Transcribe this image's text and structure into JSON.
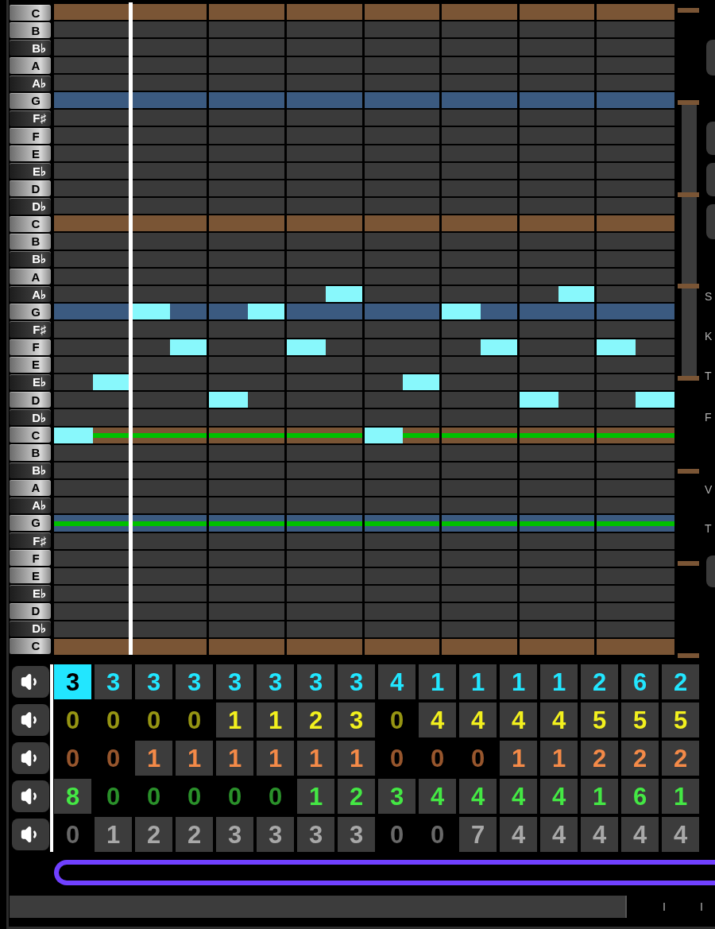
{
  "piano_roll": {
    "keys": [
      {
        "label": "C",
        "kind": "white",
        "color": "#7a5535",
        "guide": false,
        "notes": [
          false,
          false,
          false,
          false,
          false,
          false,
          false,
          false,
          false,
          false,
          false,
          false,
          false,
          false,
          false,
          false
        ]
      },
      {
        "label": "B",
        "kind": "white",
        "guide": false,
        "notes": [
          false,
          false,
          false,
          false,
          false,
          false,
          false,
          false,
          false,
          false,
          false,
          false,
          false,
          false,
          false,
          false
        ]
      },
      {
        "label": "B♭",
        "kind": "black",
        "guide": false,
        "notes": [
          false,
          false,
          false,
          false,
          false,
          false,
          false,
          false,
          false,
          false,
          false,
          false,
          false,
          false,
          false,
          false
        ]
      },
      {
        "label": "A",
        "kind": "white",
        "guide": false,
        "notes": [
          false,
          false,
          false,
          false,
          false,
          false,
          false,
          false,
          false,
          false,
          false,
          false,
          false,
          false,
          false,
          false
        ]
      },
      {
        "label": "A♭",
        "kind": "black",
        "guide": false,
        "notes": [
          false,
          false,
          false,
          false,
          false,
          false,
          false,
          false,
          false,
          false,
          false,
          false,
          false,
          false,
          false,
          false
        ]
      },
      {
        "label": "G",
        "kind": "white",
        "color": "#3b5a80",
        "guide": false,
        "notes": [
          false,
          false,
          false,
          false,
          false,
          false,
          false,
          false,
          false,
          false,
          false,
          false,
          false,
          false,
          false,
          false
        ]
      },
      {
        "label": "F♯",
        "kind": "black",
        "guide": false,
        "notes": [
          false,
          false,
          false,
          false,
          false,
          false,
          false,
          false,
          false,
          false,
          false,
          false,
          false,
          false,
          false,
          false
        ]
      },
      {
        "label": "F",
        "kind": "white",
        "guide": false,
        "notes": [
          false,
          false,
          false,
          false,
          false,
          false,
          false,
          false,
          false,
          false,
          false,
          false,
          false,
          false,
          false,
          false
        ]
      },
      {
        "label": "E",
        "kind": "white",
        "guide": false,
        "notes": [
          false,
          false,
          false,
          false,
          false,
          false,
          false,
          false,
          false,
          false,
          false,
          false,
          false,
          false,
          false,
          false
        ]
      },
      {
        "label": "E♭",
        "kind": "black",
        "guide": false,
        "notes": [
          false,
          false,
          false,
          false,
          false,
          false,
          false,
          false,
          false,
          false,
          false,
          false,
          false,
          false,
          false,
          false
        ]
      },
      {
        "label": "D",
        "kind": "white",
        "guide": false,
        "notes": [
          false,
          false,
          false,
          false,
          false,
          false,
          false,
          false,
          false,
          false,
          false,
          false,
          false,
          false,
          false,
          false
        ]
      },
      {
        "label": "D♭",
        "kind": "black",
        "guide": false,
        "notes": [
          false,
          false,
          false,
          false,
          false,
          false,
          false,
          false,
          false,
          false,
          false,
          false,
          false,
          false,
          false,
          false
        ]
      },
      {
        "label": "C",
        "kind": "white",
        "color": "#7a5535",
        "guide": false,
        "notes": [
          false,
          false,
          false,
          false,
          false,
          false,
          false,
          false,
          false,
          false,
          false,
          false,
          false,
          false,
          false,
          false
        ]
      },
      {
        "label": "B",
        "kind": "white",
        "guide": false,
        "notes": [
          false,
          false,
          false,
          false,
          false,
          false,
          false,
          false,
          false,
          false,
          false,
          false,
          false,
          false,
          false,
          false
        ]
      },
      {
        "label": "B♭",
        "kind": "black",
        "guide": false,
        "notes": [
          false,
          false,
          false,
          false,
          false,
          false,
          false,
          false,
          false,
          false,
          false,
          false,
          false,
          false,
          false,
          false
        ]
      },
      {
        "label": "A",
        "kind": "white",
        "guide": false,
        "notes": [
          false,
          false,
          false,
          false,
          false,
          false,
          false,
          false,
          false,
          false,
          false,
          false,
          false,
          false,
          false,
          false
        ]
      },
      {
        "label": "A♭",
        "kind": "black",
        "guide": false,
        "notes": [
          false,
          false,
          false,
          false,
          false,
          false,
          false,
          true,
          false,
          false,
          false,
          false,
          false,
          true,
          false,
          false
        ]
      },
      {
        "label": "G",
        "kind": "white",
        "color": "#3b5a80",
        "guide": false,
        "notes": [
          false,
          false,
          true,
          false,
          false,
          true,
          false,
          false,
          false,
          false,
          true,
          false,
          false,
          false,
          false,
          false
        ]
      },
      {
        "label": "F♯",
        "kind": "black",
        "guide": false,
        "notes": [
          false,
          false,
          false,
          false,
          false,
          false,
          false,
          false,
          false,
          false,
          false,
          false,
          false,
          false,
          false,
          false
        ]
      },
      {
        "label": "F",
        "kind": "white",
        "guide": false,
        "notes": [
          false,
          false,
          false,
          true,
          false,
          false,
          true,
          false,
          false,
          false,
          false,
          true,
          false,
          false,
          true,
          false
        ]
      },
      {
        "label": "E",
        "kind": "white",
        "guide": false,
        "notes": [
          false,
          false,
          false,
          false,
          false,
          false,
          false,
          false,
          false,
          false,
          false,
          false,
          false,
          false,
          false,
          false
        ]
      },
      {
        "label": "E♭",
        "kind": "black",
        "guide": false,
        "notes": [
          false,
          true,
          false,
          false,
          false,
          false,
          false,
          false,
          false,
          true,
          false,
          false,
          false,
          false,
          false,
          false
        ]
      },
      {
        "label": "D",
        "kind": "white",
        "guide": false,
        "notes": [
          false,
          false,
          false,
          false,
          true,
          false,
          false,
          false,
          false,
          false,
          false,
          false,
          true,
          false,
          false,
          true
        ]
      },
      {
        "label": "D♭",
        "kind": "black",
        "guide": false,
        "notes": [
          false,
          false,
          false,
          false,
          false,
          false,
          false,
          false,
          false,
          false,
          false,
          false,
          false,
          false,
          false,
          false
        ]
      },
      {
        "label": "C",
        "kind": "white",
        "color": "#7a5535",
        "guide": true,
        "notes": [
          true,
          false,
          false,
          false,
          false,
          false,
          false,
          false,
          true,
          false,
          false,
          false,
          false,
          false,
          false,
          false
        ]
      },
      {
        "label": "B",
        "kind": "white",
        "guide": false,
        "notes": [
          false,
          false,
          false,
          false,
          false,
          false,
          false,
          false,
          false,
          false,
          false,
          false,
          false,
          false,
          false,
          false
        ]
      },
      {
        "label": "B♭",
        "kind": "black",
        "guide": false,
        "notes": [
          false,
          false,
          false,
          false,
          false,
          false,
          false,
          false,
          false,
          false,
          false,
          false,
          false,
          false,
          false,
          false
        ]
      },
      {
        "label": "A",
        "kind": "white",
        "guide": false,
        "notes": [
          false,
          false,
          false,
          false,
          false,
          false,
          false,
          false,
          false,
          false,
          false,
          false,
          false,
          false,
          false,
          false
        ]
      },
      {
        "label": "A♭",
        "kind": "black",
        "guide": false,
        "notes": [
          false,
          false,
          false,
          false,
          false,
          false,
          false,
          false,
          false,
          false,
          false,
          false,
          false,
          false,
          false,
          false
        ]
      },
      {
        "label": "G",
        "kind": "white",
        "color": "#3b5a80",
        "guide": true,
        "notes": [
          false,
          false,
          false,
          false,
          false,
          false,
          false,
          false,
          false,
          false,
          false,
          false,
          false,
          false,
          false,
          false
        ]
      },
      {
        "label": "F♯",
        "kind": "black",
        "guide": false,
        "notes": [
          false,
          false,
          false,
          false,
          false,
          false,
          false,
          false,
          false,
          false,
          false,
          false,
          false,
          false,
          false,
          false
        ]
      },
      {
        "label": "F",
        "kind": "white",
        "guide": false,
        "notes": [
          false,
          false,
          false,
          false,
          false,
          false,
          false,
          false,
          false,
          false,
          false,
          false,
          false,
          false,
          false,
          false
        ]
      },
      {
        "label": "E",
        "kind": "white",
        "guide": false,
        "notes": [
          false,
          false,
          false,
          false,
          false,
          false,
          false,
          false,
          false,
          false,
          false,
          false,
          false,
          false,
          false,
          false
        ]
      },
      {
        "label": "E♭",
        "kind": "black",
        "guide": false,
        "notes": [
          false,
          false,
          false,
          false,
          false,
          false,
          false,
          false,
          false,
          false,
          false,
          false,
          false,
          false,
          false,
          false
        ]
      },
      {
        "label": "D",
        "kind": "white",
        "guide": false,
        "notes": [
          false,
          false,
          false,
          false,
          false,
          false,
          false,
          false,
          false,
          false,
          false,
          false,
          false,
          false,
          false,
          false
        ]
      },
      {
        "label": "D♭",
        "kind": "black",
        "guide": false,
        "notes": [
          false,
          false,
          false,
          false,
          false,
          false,
          false,
          false,
          false,
          false,
          false,
          false,
          false,
          false,
          false,
          false
        ]
      },
      {
        "label": "C",
        "kind": "white",
        "color": "#7a5535",
        "guide": false,
        "notes": [
          false,
          false,
          false,
          false,
          false,
          false,
          false,
          false,
          false,
          false,
          false,
          false,
          false,
          false,
          false,
          false
        ]
      }
    ]
  },
  "side_labels": [
    "S",
    "K",
    "T",
    "F",
    "V",
    "T"
  ],
  "tracks": [
    {
      "color": "#22e6ff",
      "cells": [
        {
          "value": "3",
          "active": true,
          "selected": true
        },
        {
          "value": "3",
          "active": true,
          "selected": false
        },
        {
          "value": "3",
          "active": true,
          "selected": false
        },
        {
          "value": "3",
          "active": true,
          "selected": false
        },
        {
          "value": "3",
          "active": true,
          "selected": false
        },
        {
          "value": "3",
          "active": true,
          "selected": false
        },
        {
          "value": "3",
          "active": true,
          "selected": false
        },
        {
          "value": "3",
          "active": true,
          "selected": false
        },
        {
          "value": "4",
          "active": true,
          "selected": false
        },
        {
          "value": "1",
          "active": true,
          "selected": false
        },
        {
          "value": "1",
          "active": true,
          "selected": false
        },
        {
          "value": "1",
          "active": true,
          "selected": false
        },
        {
          "value": "1",
          "active": true,
          "selected": false
        },
        {
          "value": "2",
          "active": true,
          "selected": false
        },
        {
          "value": "6",
          "active": true,
          "selected": false
        },
        {
          "value": "2",
          "active": true,
          "selected": false
        }
      ]
    },
    {
      "color": "#f2f01e",
      "cells": [
        {
          "value": "0",
          "active": false,
          "selected": false
        },
        {
          "value": "0",
          "active": false,
          "selected": false
        },
        {
          "value": "0",
          "active": false,
          "selected": false
        },
        {
          "value": "0",
          "active": false,
          "selected": false
        },
        {
          "value": "1",
          "active": true,
          "selected": false
        },
        {
          "value": "1",
          "active": true,
          "selected": false
        },
        {
          "value": "2",
          "active": true,
          "selected": false
        },
        {
          "value": "3",
          "active": true,
          "selected": false
        },
        {
          "value": "0",
          "active": false,
          "selected": false
        },
        {
          "value": "4",
          "active": true,
          "selected": false
        },
        {
          "value": "4",
          "active": true,
          "selected": false
        },
        {
          "value": "4",
          "active": true,
          "selected": false
        },
        {
          "value": "4",
          "active": true,
          "selected": false
        },
        {
          "value": "5",
          "active": true,
          "selected": false
        },
        {
          "value": "5",
          "active": true,
          "selected": false
        },
        {
          "value": "5",
          "active": true,
          "selected": false
        }
      ]
    },
    {
      "color": "#f48a48",
      "cells": [
        {
          "value": "0",
          "active": false,
          "selected": false
        },
        {
          "value": "0",
          "active": false,
          "selected": false
        },
        {
          "value": "1",
          "active": true,
          "selected": false
        },
        {
          "value": "1",
          "active": true,
          "selected": false
        },
        {
          "value": "1",
          "active": true,
          "selected": false
        },
        {
          "value": "1",
          "active": true,
          "selected": false
        },
        {
          "value": "1",
          "active": true,
          "selected": false
        },
        {
          "value": "1",
          "active": true,
          "selected": false
        },
        {
          "value": "0",
          "active": false,
          "selected": false
        },
        {
          "value": "0",
          "active": false,
          "selected": false
        },
        {
          "value": "0",
          "active": false,
          "selected": false
        },
        {
          "value": "1",
          "active": true,
          "selected": false
        },
        {
          "value": "1",
          "active": true,
          "selected": false
        },
        {
          "value": "2",
          "active": true,
          "selected": false
        },
        {
          "value": "2",
          "active": true,
          "selected": false
        },
        {
          "value": "2",
          "active": true,
          "selected": false
        }
      ]
    },
    {
      "color": "#44e844",
      "cells": [
        {
          "value": "8",
          "active": true,
          "selected": false
        },
        {
          "value": "0",
          "active": false,
          "selected": false
        },
        {
          "value": "0",
          "active": false,
          "selected": false
        },
        {
          "value": "0",
          "active": false,
          "selected": false
        },
        {
          "value": "0",
          "active": false,
          "selected": false
        },
        {
          "value": "0",
          "active": false,
          "selected": false
        },
        {
          "value": "1",
          "active": true,
          "selected": false
        },
        {
          "value": "2",
          "active": true,
          "selected": false
        },
        {
          "value": "3",
          "active": true,
          "selected": false
        },
        {
          "value": "4",
          "active": true,
          "selected": false
        },
        {
          "value": "4",
          "active": true,
          "selected": false
        },
        {
          "value": "4",
          "active": true,
          "selected": false
        },
        {
          "value": "4",
          "active": true,
          "selected": false
        },
        {
          "value": "1",
          "active": true,
          "selected": false
        },
        {
          "value": "6",
          "active": true,
          "selected": false
        },
        {
          "value": "1",
          "active": true,
          "selected": false
        }
      ]
    },
    {
      "color": "#a8a8a8",
      "cells": [
        {
          "value": "0",
          "active": false,
          "selected": false
        },
        {
          "value": "1",
          "active": true,
          "selected": false
        },
        {
          "value": "2",
          "active": true,
          "selected": false
        },
        {
          "value": "2",
          "active": true,
          "selected": false
        },
        {
          "value": "3",
          "active": true,
          "selected": false
        },
        {
          "value": "3",
          "active": true,
          "selected": false
        },
        {
          "value": "3",
          "active": true,
          "selected": false
        },
        {
          "value": "3",
          "active": true,
          "selected": false
        },
        {
          "value": "0",
          "active": false,
          "selected": false
        },
        {
          "value": "0",
          "active": false,
          "selected": false
        },
        {
          "value": "7",
          "active": true,
          "selected": false
        },
        {
          "value": "4",
          "active": true,
          "selected": false
        },
        {
          "value": "4",
          "active": true,
          "selected": false
        },
        {
          "value": "4",
          "active": true,
          "selected": false
        },
        {
          "value": "4",
          "active": true,
          "selected": false
        },
        {
          "value": "4",
          "active": true,
          "selected": false
        }
      ]
    }
  ]
}
